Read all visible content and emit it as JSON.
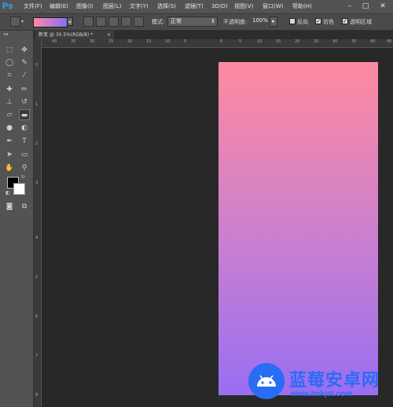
{
  "app": {
    "logo": "Ps"
  },
  "menu": {
    "items": [
      "文件(F)",
      "编辑(E)",
      "图像(I)",
      "图层(L)",
      "文字(Y)",
      "选择(S)",
      "滤镜(T)",
      "3D(D)",
      "视图(V)",
      "窗口(W)",
      "帮助(H)"
    ],
    "window_buttons": [
      "–",
      "□",
      "✕"
    ]
  },
  "options": {
    "mode_label": "模式:",
    "mode_value": "正常",
    "opacity_label": "不透明度:",
    "opacity_value": "100%",
    "reverse_label": "反向",
    "dither_label": "仿色",
    "transparency_label": "透明区域",
    "reverse_checked": false,
    "dither_checked": true,
    "transparency_checked": true,
    "gradient_colors": [
      "#ff8aa0",
      "#8a6cf5"
    ]
  },
  "document": {
    "tab_title": "新变 @ 30.5%(RGB/8) *",
    "gradient_colors": [
      "#ff8aa0",
      "#c87fd0",
      "#9a6ef2"
    ]
  },
  "rulers": {
    "top": [
      "40",
      "35",
      "30",
      "25",
      "20",
      "15",
      "10",
      "5",
      "0",
      "5",
      "10",
      "15",
      "20",
      "25",
      "30",
      "35",
      "40",
      "45"
    ],
    "left": [
      "0",
      "1",
      "2",
      "3",
      "4",
      "5",
      "6",
      "7",
      "8"
    ]
  },
  "watermark": {
    "title": "蓝莓安卓网",
    "url": "www.lmkjst.com"
  }
}
